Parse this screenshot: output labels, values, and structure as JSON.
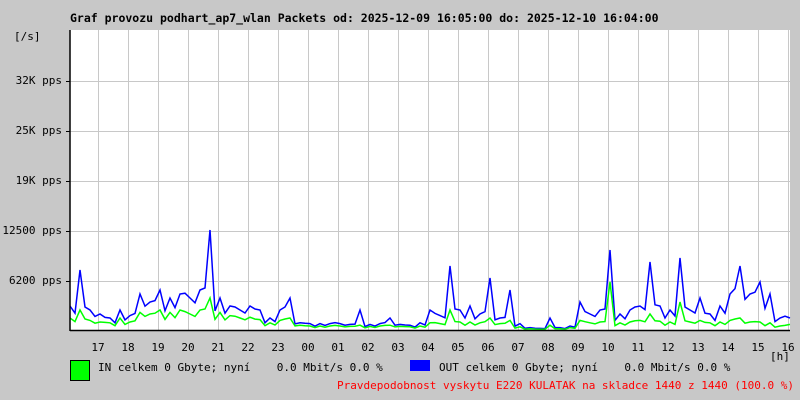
{
  "chart_data": {
    "type": "line",
    "title": "Graf provozu podhart_ap7_wlan Packets od: 2025-12-09 16:05:00 do: 2025-12-10 16:04:00",
    "ylabel": "[/s]",
    "xlabel": "[h]",
    "ylim": [
      0,
      37500
    ],
    "xlim_hours": [
      16.083,
      40.067
    ],
    "grid": true,
    "y_ticks": [
      {
        "value": 6200,
        "label": "6200 pps"
      },
      {
        "value": 12500,
        "label": "12500 pps"
      },
      {
        "value": 19000,
        "label": "19K pps"
      },
      {
        "value": 25000,
        "label": "25K pps"
      },
      {
        "value": 32000,
        "label": "32K pps"
      }
    ],
    "x_ticks": [
      "17",
      "18",
      "19",
      "20",
      "21",
      "22",
      "23",
      "00",
      "01",
      "02",
      "03",
      "04",
      "05",
      "06",
      "07",
      "08",
      "09",
      "10",
      "11",
      "12",
      "13",
      "14",
      "15",
      "16"
    ],
    "sample_interval_minutes": 20,
    "series": [
      {
        "name": "OUT",
        "color": "#0000ff",
        "values": [
          3000,
          7500,
          2500,
          2000,
          1500,
          2500,
          1800,
          4500,
          3500,
          5000,
          4000,
          4500,
          4000,
          5000,
          12500,
          4000,
          3000,
          2500,
          3000,
          2500,
          1500,
          2500,
          4000,
          900,
          800,
          800,
          800,
          800,
          700,
          2500,
          700,
          800,
          1500,
          700,
          600,
          900,
          2500,
          1800,
          8000,
          2500,
          3000,
          2000,
          6500,
          1500,
          5000,
          800,
          300,
          200,
          1500,
          300,
          500,
          3500,
          2000,
          2500,
          10000,
          2000,
          2500,
          3000,
          8500,
          3000,
          2500,
          9000,
          2500,
          4000,
          2000,
          3000,
          4500,
          8000,
          4500,
          6000,
          4500,
          1500,
          1500
        ]
      },
      {
        "name": "IN",
        "color": "#00ff00",
        "values": [
          1500,
          2500,
          1200,
          1000,
          900,
          1500,
          1000,
          2200,
          2000,
          2500,
          2200,
          2500,
          2000,
          2500,
          4000,
          2200,
          1800,
          1500,
          1600,
          1300,
          900,
          1200,
          1500,
          600,
          500,
          500,
          500,
          500,
          450,
          600,
          450,
          500,
          600,
          450,
          400,
          500,
          900,
          800,
          2500,
          1000,
          1000,
          900,
          1500,
          800,
          1200,
          400,
          150,
          100,
          600,
          150,
          300,
          1200,
          900,
          1000,
          6000,
          900,
          1000,
          1200,
          2000,
          1100,
          1000,
          3500,
          1000,
          1200,
          900,
          1000,
          1200,
          1500,
          1000,
          1000,
          900,
          500,
          700
        ]
      }
    ]
  },
  "legend": {
    "in_text": "IN celkem 0 Gbyte; nyní    0.0 Mbit/s 0.0 %",
    "out_text": "OUT celkem 0 Gbyte; nyní    0.0 Mbit/s 0.0 %"
  },
  "note": "Pravdepodobnost vyskytu E220 KULATAK na skladce 1440 z 1440 (100.0 %)"
}
